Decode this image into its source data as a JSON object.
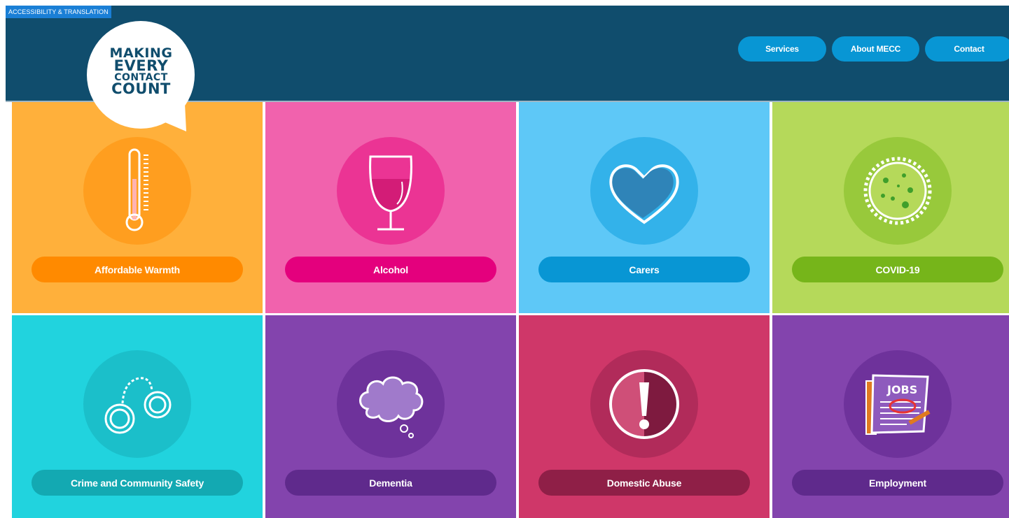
{
  "accessibility": {
    "label": "ACCESSIBILITY & TRANSLATION"
  },
  "header": {
    "logo": {
      "line1": "MAKING",
      "line2": "EVERY",
      "line3": "CONTACT",
      "line4": "COUNT"
    },
    "nav": [
      {
        "label": "Services"
      },
      {
        "label": "About MECC"
      },
      {
        "label": "Contact"
      }
    ]
  },
  "topics": [
    {
      "label": "Affordable Warmth",
      "icon": "thermometer-icon",
      "bg": "#ffb03b",
      "circle": "#ff9e1f",
      "pill": "#ff8a00"
    },
    {
      "label": "Alcohol",
      "icon": "wine-glass-icon",
      "bg": "#f162ad",
      "circle": "#eb3494",
      "pill": "#e4007d"
    },
    {
      "label": "Carers",
      "icon": "heart-icon",
      "bg": "#5ec8f7",
      "circle": "#33b2ea",
      "pill": "#0896d4"
    },
    {
      "label": "COVID-19",
      "icon": "virus-icon",
      "bg": "#b5d95a",
      "circle": "#98c93b",
      "pill": "#76b51a"
    },
    {
      "label": "Crime and Community Safety",
      "icon": "handcuffs-icon",
      "bg": "#21d3de",
      "circle": "#1bbfca",
      "pill": "#13a9b2"
    },
    {
      "label": "Dementia",
      "icon": "thought-bubble-icon",
      "bg": "#8344ad",
      "circle": "#6e329b",
      "pill": "#5f2a8c"
    },
    {
      "label": "Domestic Abuse",
      "icon": "warning-icon",
      "bg": "#cf3769",
      "circle": "#b12b5a",
      "pill": "#8f1f47"
    },
    {
      "label": "Employment",
      "icon": "newspaper-jobs-icon",
      "bg": "#8344ad",
      "circle": "#6e329b",
      "pill": "#5f2a8c"
    }
  ]
}
